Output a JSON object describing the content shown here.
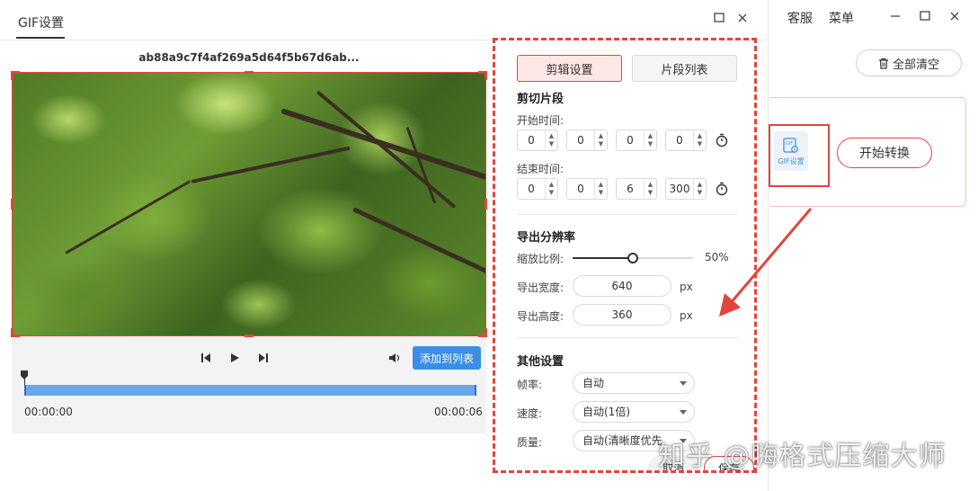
{
  "dialog": {
    "title": "GIF设置",
    "file_name": "ab88a9c7f4af269a5d64f5b67d6ab...",
    "add_to_list_label": "添加到列表",
    "time_start": "00:00:00",
    "time_end": "00:00:06"
  },
  "settings": {
    "tabs": [
      {
        "label": "剪辑设置",
        "active": true
      },
      {
        "label": "片段列表",
        "active": false
      }
    ],
    "clip": {
      "title": "剪切片段",
      "start_label": "开始时间:",
      "start_values": [
        "0",
        "0",
        "0",
        "0"
      ],
      "end_label": "结束时间:",
      "end_values": [
        "0",
        "0",
        "6",
        "300"
      ]
    },
    "resolution": {
      "title": "导出分辨率",
      "scale_label": "缩放比例:",
      "scale_value": "50%",
      "scale_fraction": 0.5,
      "width_label": "导出宽度:",
      "width_value": "640",
      "height_label": "导出高度:",
      "height_value": "360",
      "unit": "px"
    },
    "other": {
      "title": "其他设置",
      "fps_label": "帧率:",
      "fps_value": "自动",
      "speed_label": "速度:",
      "speed_value": "自动(1倍)",
      "quality_label": "质量:",
      "quality_value": "自动(清晰度优先"
    },
    "cancel_label": "取消",
    "save_label": "保存"
  },
  "app": {
    "service_label": "客服",
    "menu_label": "菜单",
    "clear_all_label": "全部清空",
    "gif_tile_label": "GIF设置",
    "start_convert_label": "开始转换"
  },
  "watermark": "知乎 @嗨格式压缩大师",
  "colors": {
    "accent_red": "#e1453c",
    "primary_blue": "#3a8ee6"
  }
}
